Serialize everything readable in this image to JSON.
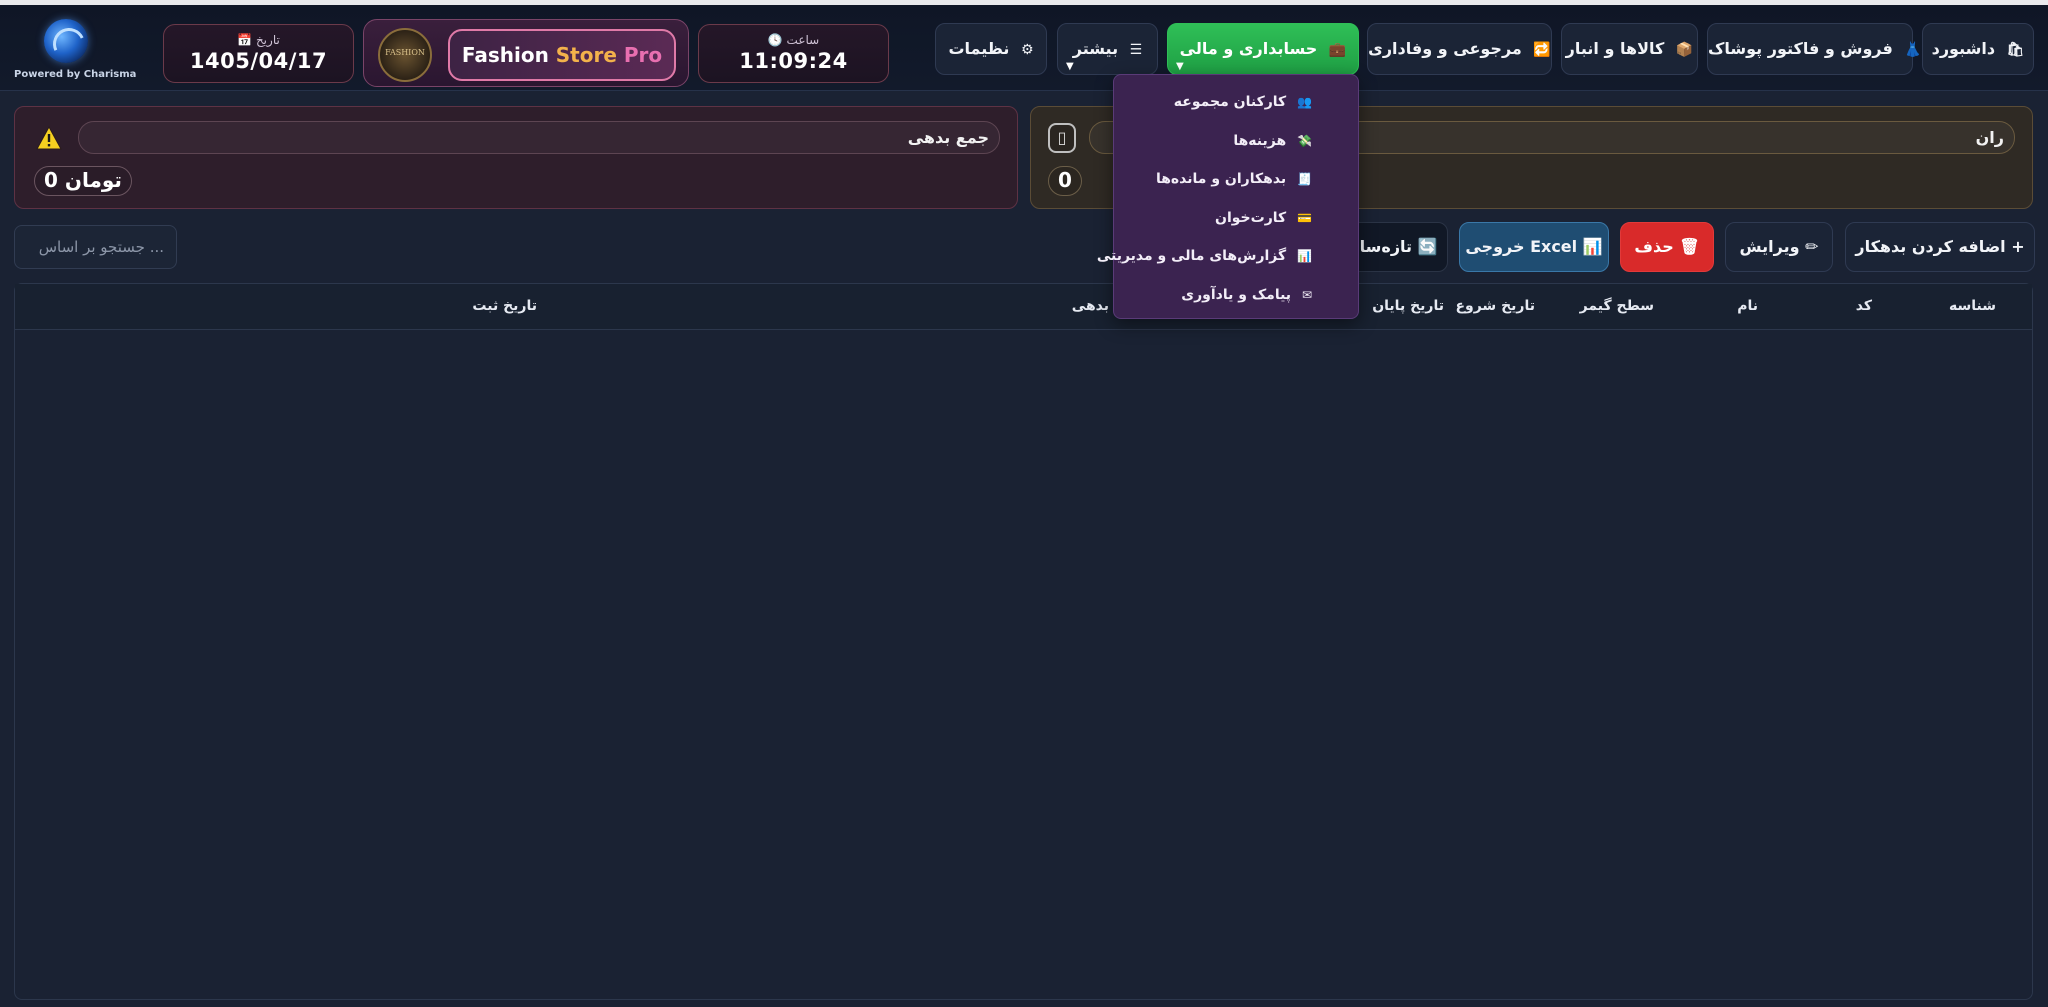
{
  "brand": {
    "powered_by": "Powered by Charisma"
  },
  "date": {
    "label": "📅 تاریخ",
    "value": "1405/04/17"
  },
  "store": {
    "logo_text": "FASHION",
    "title_w1": "Fashion",
    "title_w2": "Store",
    "title_w3": "Pro"
  },
  "clock": {
    "label": "🕓 ساعت",
    "value": "11:09:24"
  },
  "nav": {
    "settings": {
      "label": "نظیمات",
      "icon": "⚙"
    },
    "more": {
      "label": "بیشتر",
      "icon": "☰"
    },
    "accounting": {
      "label": "حسابداری و مالی",
      "icon": "💼"
    },
    "returns": {
      "label": "مرجوعی و وفاداری",
      "icon": "🔁"
    },
    "goods": {
      "label": "کالاها و انبار",
      "icon": "📦"
    },
    "sales": {
      "label": "فروش و فاکتور پوشاک",
      "icon": "👗"
    },
    "dashboard": {
      "label": "داشبورد",
      "icon": "🛍"
    }
  },
  "cards": {
    "debt": {
      "title": "جمع بدهی",
      "value": "0 تومان"
    },
    "debtors": {
      "title": "ران",
      "value": "0"
    }
  },
  "search": {
    "placeholder": "جستجو بر اساس ..."
  },
  "actions": {
    "refresh": {
      "label": "تازه‌ساز",
      "icon": "🔄"
    },
    "excel": {
      "label": "خروجی Excel",
      "icon": "📊"
    },
    "delete": {
      "label": "حذف",
      "icon": "🗑"
    },
    "edit": {
      "label": "ویرایش",
      "icon": "✏"
    },
    "add": {
      "label": "اضافه کردن بدهکار",
      "icon": "+"
    }
  },
  "table": {
    "columns": [
      "شناسه",
      "کد",
      "نام",
      "سطح گیمر",
      "تاریخ شروع",
      "تاریخ پایان",
      "بدهی",
      "تاریخ ثبت"
    ],
    "rows": []
  },
  "dropdown": {
    "items": [
      {
        "label": "کارکنان مجموعه",
        "icon": "👥"
      },
      {
        "label": "هزینه‌ها",
        "icon": "💸"
      },
      {
        "label": "بدهکاران و مانده‌ها",
        "icon": "🧾"
      },
      {
        "label": "کارت‌خوان",
        "icon": "💳"
      },
      {
        "label": "گزارش‌های مالی و مدیریتی",
        "icon": "📊"
      },
      {
        "label": "پیامک و یادآوری",
        "icon": "✉"
      }
    ]
  },
  "colors": {
    "accent_green": "#2fbf57",
    "danger_red": "#d92a2a",
    "excel_blue": "#1f4d72",
    "menu_purple": "#3b2350"
  }
}
